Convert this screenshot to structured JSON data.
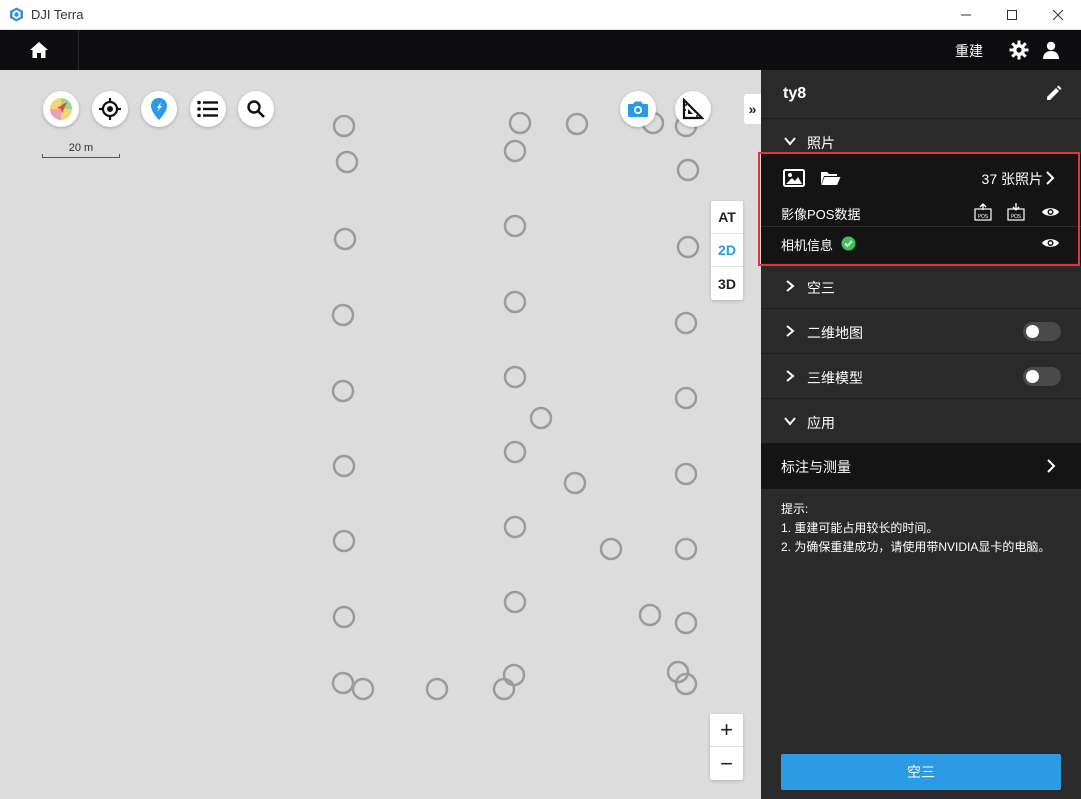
{
  "window": {
    "title": "DJI Terra"
  },
  "topnav": {
    "rebuild_label": "重建"
  },
  "map": {
    "scale_label": "20 m",
    "view_modes": [
      {
        "label": "AT",
        "active": false
      },
      {
        "label": "2D",
        "active": true
      },
      {
        "label": "3D",
        "active": false
      }
    ],
    "zoom_in": "+",
    "zoom_out": "−",
    "collapse": "»"
  },
  "panel": {
    "title": "ty8",
    "photos_section": "照片",
    "photo_count": "37 张照片",
    "pos_data_label": "影像POS数据",
    "camera_info_label": "相机信息",
    "at_section": "空三",
    "map2d_section": "二维地图",
    "model3d_section": "三维模型",
    "apps_section": "应用",
    "annotate_label": "标注与测量",
    "tips_title": "提示:",
    "tip1": "1. 重建可能占用较长的时间。",
    "tip2": "2. 为确保重建成功，请使用带NVIDIA显卡的电脑。",
    "action_button": "空三"
  },
  "colors": {
    "accent": "#2c9be6",
    "panel_bg": "#2a2a2a",
    "highlight_frame": "#e5323a",
    "map_bg": "#dcdcdc"
  }
}
